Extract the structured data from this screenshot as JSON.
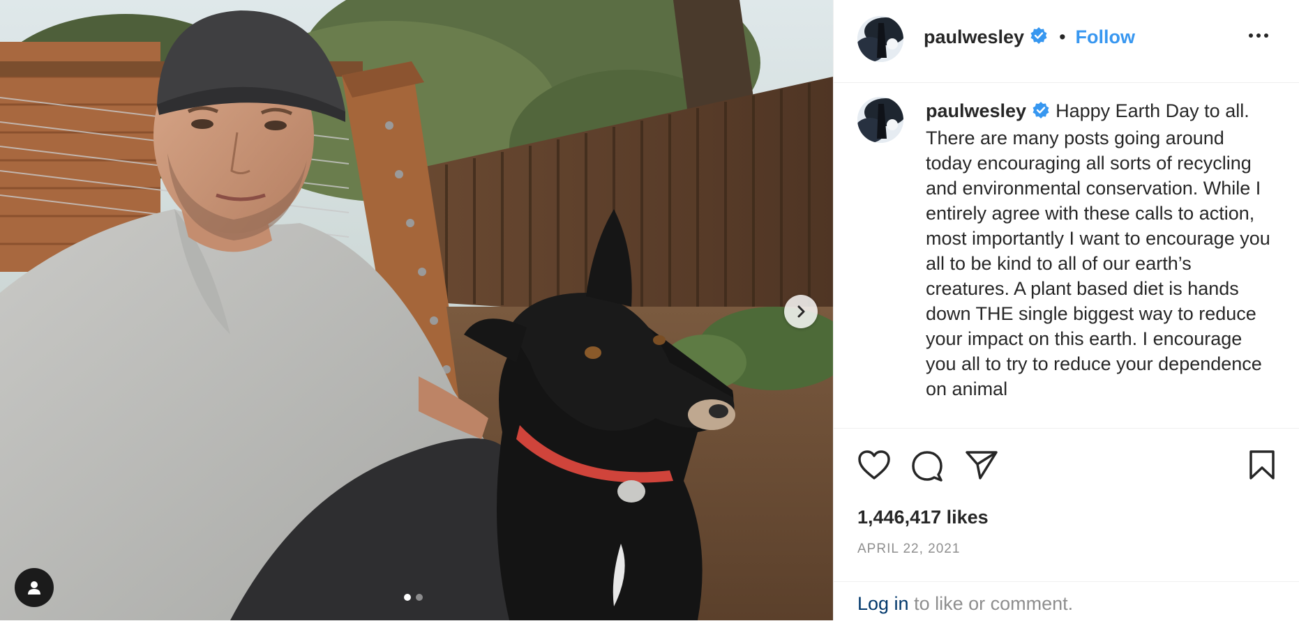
{
  "post": {
    "username": "paulwesley",
    "follow_label": "Follow",
    "dot_separator": "•",
    "caption": "Happy Earth Day to all. There are many posts going around today encouraging all sorts of recycling and environmental conservation. While I entirely agree with these calls to action, most importantly I want to encourage you all to be kind to all of our earth’s creatures. A plant based diet is hands down THE single biggest way to reduce your impact on this earth. I encourage you all to try to reduce your dependence on animal",
    "likes": "1,446,417 likes",
    "date": "APRIL 22, 2021",
    "verified": true,
    "carousel": {
      "slide_count": 2,
      "active_index": 0
    }
  },
  "login_prompt": {
    "link": "Log in",
    "text": " to like or comment."
  },
  "icons": {
    "like": "heart-icon",
    "comment": "comment-icon",
    "share": "paper-plane-icon",
    "save": "bookmark-icon",
    "more": "more-options-icon",
    "verified": "verified-badge-icon",
    "next": "chevron-right-icon",
    "tagged": "user-icon"
  },
  "colors": {
    "accent": "#3897f0",
    "verified": "#3797f0",
    "text": "#262626",
    "muted": "#8e8e8e",
    "link": "#00376b"
  }
}
